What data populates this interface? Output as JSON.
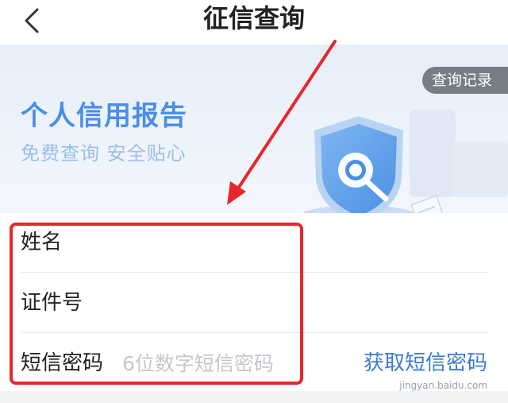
{
  "nav": {
    "title": "征信查询"
  },
  "banner": {
    "title": "个人信用报告",
    "subtitle": "免费查询 安全贴心",
    "records_button": "查询记录"
  },
  "form": {
    "name_label": "姓名",
    "id_label": "证件号",
    "sms_label": "短信密码",
    "sms_placeholder": "6位数字短信密码",
    "sms_button": "获取短信密码"
  },
  "watermark": "jingyan.baidu.com",
  "colors": {
    "accent": "#3a7bd5",
    "banner_title": "#4a8ee8",
    "highlight": "#e8262d"
  }
}
